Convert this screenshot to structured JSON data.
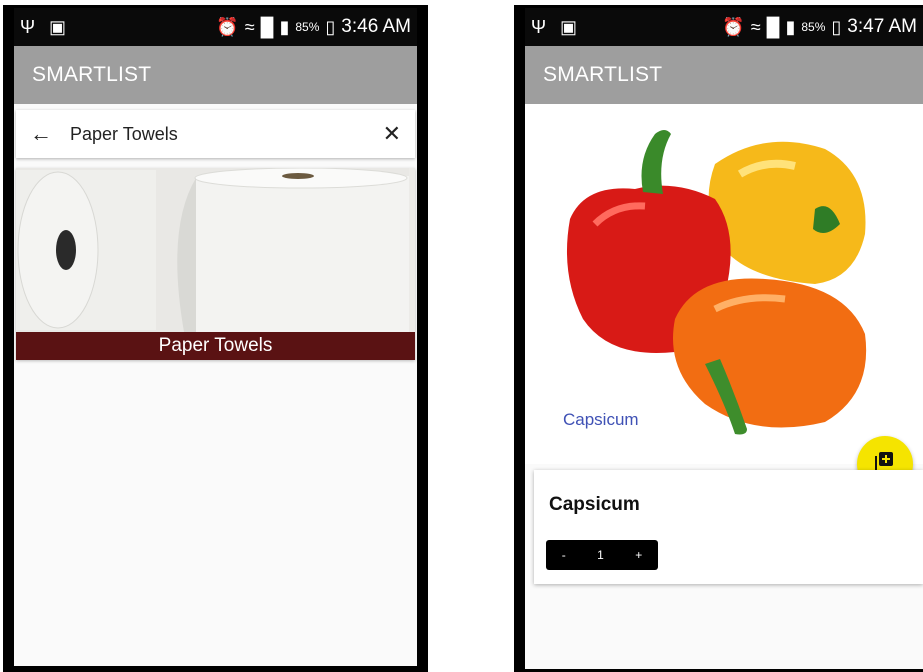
{
  "left_screen": {
    "status": {
      "battery": "85%",
      "time": "3:46 AM"
    },
    "app_title": "SMARTLIST",
    "search": {
      "query": "Paper Towels"
    },
    "result": {
      "caption": "Paper Towels"
    }
  },
  "right_screen": {
    "status": {
      "battery": "85%",
      "time": "3:47 AM"
    },
    "app_title": "SMARTLIST",
    "hero": {
      "label": "Capsicum"
    },
    "item": {
      "name": "Capsicum",
      "quantity": "1",
      "decrement": "-",
      "increment": "+"
    },
    "fab": {
      "icon": "add-to-list-icon",
      "color": "#f5e400"
    }
  },
  "colors": {
    "appbar": "#9e9e9e",
    "caption_bg": "#5a1213",
    "hero_label": "#3f51b5"
  }
}
